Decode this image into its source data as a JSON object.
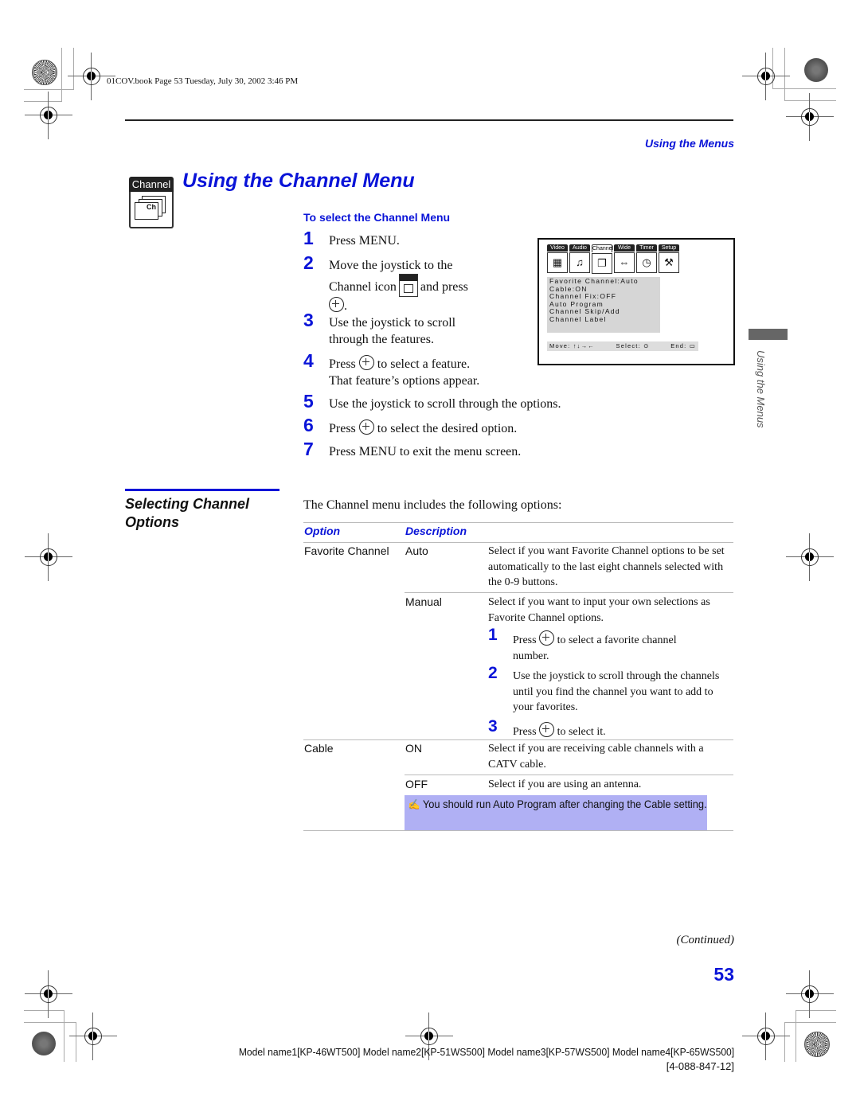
{
  "header": {
    "book_info": "01COV.book  Page 53  Tuesday, July 30, 2002  3:46 PM",
    "section_label": "Using the Menus"
  },
  "title": {
    "badge_label": "Channel",
    "badge_icon_text": "Ch",
    "text": "Using the Channel Menu"
  },
  "select_menu": {
    "heading": "To select the Channel Menu",
    "steps": [
      {
        "num": "1",
        "text": "Press MENU."
      },
      {
        "num": "2",
        "text_a": "Move the joystick to the",
        "text_b": "Channel icon",
        "text_c": "and press",
        "text_d": "."
      },
      {
        "num": "3",
        "text": "Use the joystick to scroll through the features."
      },
      {
        "num": "4",
        "text_a": "Press",
        "text_b": "to select a feature.",
        "text_c": "That feature’s options appear."
      },
      {
        "num": "5",
        "text": "Use the joystick to scroll through the options."
      },
      {
        "num": "6",
        "text_a": "Press",
        "text_b": "to select the desired option."
      },
      {
        "num": "7",
        "text": "Press MENU to exit the menu screen."
      }
    ]
  },
  "menu_screen": {
    "tabs": [
      {
        "label": "Video",
        "icon": "video-icon",
        "glyph": "▦"
      },
      {
        "label": "Audio",
        "icon": "audio-icon",
        "glyph": "♫"
      },
      {
        "label": "Channel",
        "icon": "channel-icon",
        "glyph": "❐",
        "active": true
      },
      {
        "label": "Wide",
        "icon": "wide-icon",
        "glyph": "⇔"
      },
      {
        "label": "Timer",
        "icon": "timer-icon",
        "glyph": "◷"
      },
      {
        "label": "Setup",
        "icon": "setup-icon",
        "glyph": "⚒"
      }
    ],
    "items": [
      "Favorite Channel:Auto",
      "Cable:ON",
      "Channel Fix:OFF",
      "Auto Program",
      "Channel Skip/Add",
      "Channel Label"
    ],
    "footer": {
      "move": "Move: ↑↓→←",
      "select": "Select: ⊙",
      "end": "End: ▭"
    }
  },
  "side_tab": "Using the Menus",
  "options_section": {
    "title_line1": "Selecting Channel",
    "title_line2": "Options",
    "intro": "The Channel menu includes the following options:",
    "col_option": "Option",
    "col_description": "Description",
    "rows": {
      "fav_option": "Favorite Channel",
      "auto_value": "Auto",
      "auto_desc": "Select if you want Favorite Channel options to be set automatically to the last eight channels selected with the 0-9 buttons.",
      "manual_value": "Manual",
      "manual_desc": "Select if you want to input your own selections as Favorite Channel options.",
      "manual_steps": [
        {
          "num": "1",
          "text_a": "Press",
          "text_b": "to select a favorite channel number."
        },
        {
          "num": "2",
          "text": "Use the joystick to scroll through the channels until you find the channel you want to add to your favorites."
        },
        {
          "num": "3",
          "text_a": "Press",
          "text_b": "to select it."
        }
      ],
      "cable_option": "Cable",
      "on_value": "ON",
      "on_desc": "Select if you are receiving cable channels with a CATV cable.",
      "off_value": "OFF",
      "off_desc": "Select if you are using an antenna.",
      "note": "You should run Auto Program after changing the Cable setting."
    }
  },
  "footer": {
    "continued": "(Continued)",
    "page_number": "53",
    "models": "Model name1[KP-46WT500] Model name2[KP-51WS500] Model name3[KP-57WS500] Model name4[KP-65WS500]",
    "part_number": "[4-088-847-12]"
  }
}
